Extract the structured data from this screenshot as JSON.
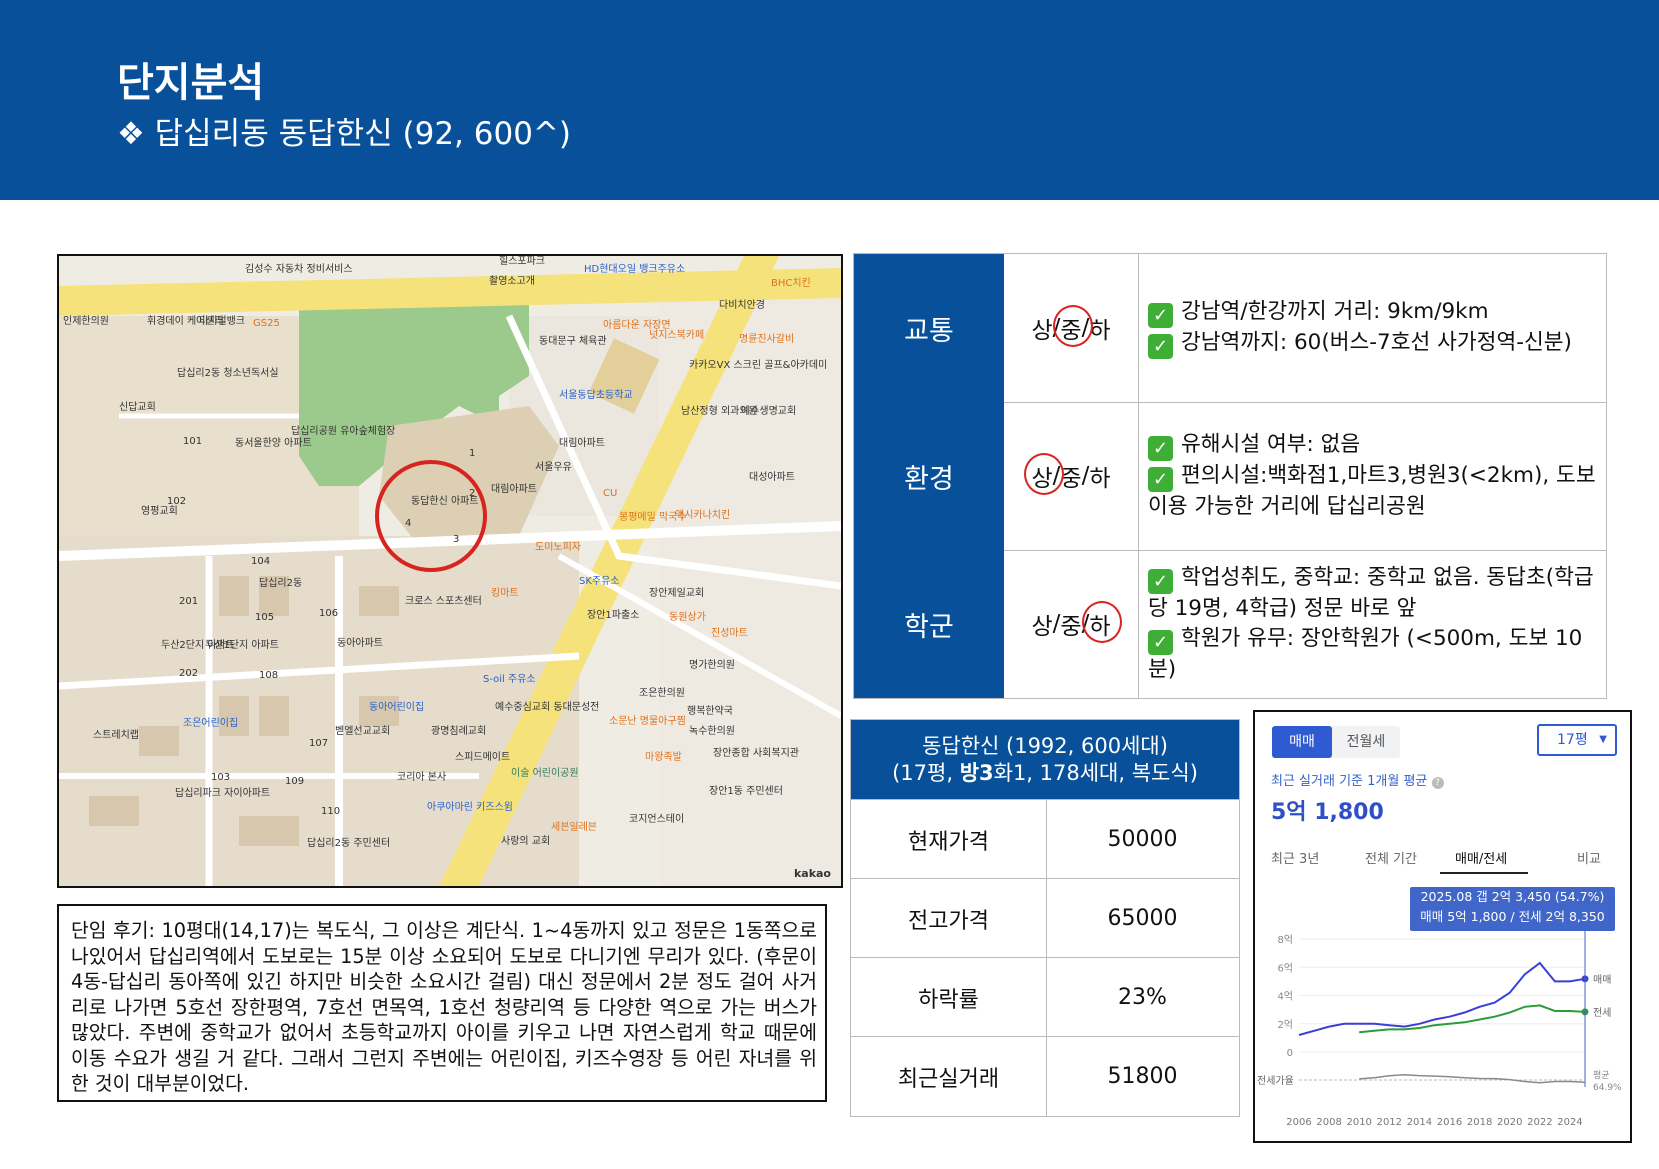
{
  "header": {
    "title": "단지분석",
    "subtitle": "❖ 답십리동 동답한신 (92, 600^)"
  },
  "map": {
    "labels": [
      "김성수 자동차 정비서비스",
      "힐스포파크",
      "HD현대오일 뱅크주유소",
      "인제한의원",
      "휘경데이 케어센터",
      "디지털뱅크",
      "GS25",
      "촬영소고개",
      "동대문구 체육관",
      "아름다운 자장면",
      "넛지스북카페",
      "다비치안경",
      "BHC치킨",
      "명륜진사갈비",
      "답십리2동 청소년독서실",
      "서울동답초등학교",
      "카카오VX 스크린 골프&아카데미",
      "신답교회",
      "남산정형 외과의원",
      "예수생명교회",
      "동서울한양 아파트",
      "답십리공원 유아숲체험장",
      "대림아파트",
      "동답한신 아파트",
      "서울우유",
      "대림아파트",
      "CU",
      "봉평메밀 막국수",
      "엑시카나치킨",
      "대성아파트",
      "영평교회",
      "도미노피자",
      "SK주유소",
      "답십리2동",
      "크로스 스포츠센터",
      "킹마트",
      "장안제일교회",
      "장안1파출소",
      "동원상가",
      "진성마트",
      "두산2단지 아파트",
      "두산1단지 아파트",
      "동아아파트",
      "S-oil 주유소",
      "명가한의원",
      "조은어린이집",
      "동아어린이집",
      "예수중심교회 동대문성전",
      "조은한의원",
      "행복한약국",
      "소문난 명물아구찜",
      "녹수한의원",
      "스트레치랩",
      "벧엘선교교회",
      "광명침례교회",
      "스피드메이트",
      "마왕족발",
      "장안종합 사회복지관",
      "답십리파크 자이아파트",
      "코리아 본사",
      "이술 어린이공원",
      "장안1동 주민센터",
      "아쿠아마린 키즈스윔",
      "세븐일레븐",
      "코지언스테이",
      "사랑의 교회",
      "답십리2동 주민센터",
      "kakao"
    ],
    "numbers": [
      "101",
      "102",
      "103",
      "104",
      "105",
      "106",
      "107",
      "108",
      "109",
      "110",
      "201",
      "202",
      "1",
      "2",
      "3",
      "4"
    ]
  },
  "note": {
    "text": "단임 후기: 10평대(14,17)는 복도식, 그 이상은 계단식. 1~4동까지 있고 정문은 1동쪽으로 나있어서 답십리역에서 도보로는 15분 이상 소요되어 도보로 다니기엔 무리가 있다. (후문이 4동-답십리 동아쪽에 있긴 하지만 비슷한 소요시간 걸림) 대신 정문에서 2분 정도 걸어 사거리로 나가면 5호선 장한평역, 7호선 면목역, 1호선 청량리역 등 다양한 역으로 가는 버스가 많았다. 주변에 중학교가 없어서 초등학교까지 아이를 키우고 나면 자연스럽게 학교 때문에 이동 수요가 생길 거 같다. 그래서 그런지 주변에는 어린이집, 키즈수영장 등 어린 자녀를 위한 것이 대부분이었다."
  },
  "evaluation": [
    {
      "category": "교통",
      "g1": "상",
      "s1": " / ",
      "g2": "중",
      "s2": " / ",
      "g3": "하",
      "selected": "중",
      "lines": [
        "강남역/한강까지 거리: 9km/9km",
        "강남역까지: 60(버스-7호선 사가정역-신분)"
      ]
    },
    {
      "category": "환경",
      "g1": "상",
      "s1": " / ",
      "g2": "중",
      "s2": " / ",
      "g3": "하",
      "selected": "상",
      "lines": [
        "유해시설 여부: 없음",
        "편의시설:백화점1,마트3,병원3(<2km), 도보 이용 가능한 거리에 답십리공원"
      ]
    },
    {
      "category": "학군",
      "g1": "상",
      "s1": " / ",
      "g2": "중",
      "s2": " / ",
      "g3": "하",
      "selected": "하",
      "lines": [
        "학업성취도, 중학교: 중학교 없음. 동답초(학급당 19명, 4학급) 정문 바로 앞",
        "학원가 유무: 장안학원가 (<500m, 도보 10분)"
      ]
    }
  ],
  "price_table": {
    "title_line1": "동답한신 (1992, 600세대)",
    "title_line2_a": "(17평, ",
    "title_line2_b": "방3",
    "title_line2_c": "화1, 178세대, 복도식)",
    "rows": [
      {
        "label": "현재가격",
        "value": "50000"
      },
      {
        "label": "전고가격",
        "value": "65000"
      },
      {
        "label": "하락률",
        "value": "23%"
      },
      {
        "label": "최근실거래",
        "value": "51800"
      }
    ]
  },
  "chart_panel": {
    "tab_sale": "매매",
    "tab_rent": "전월세",
    "size_select": "17평",
    "subtitle": "최근 실거래 기준 1개월 평균",
    "avg_price": "5억 1,800",
    "period_tabs": [
      "최근 3년",
      "전체 기간",
      "매매/전세",
      "비교"
    ],
    "active_period_tab": "매매/전세",
    "tooltip_line1": "2025.08  갭 2억 3,450 (54.7%)",
    "tooltip_line2": "매매 5억 1,800 / 전세 2억 8,350",
    "ratio_label": "전세가율",
    "avg_label": "평균",
    "avg_ratio": "64.9%"
  },
  "chart_data": {
    "type": "line",
    "x": [
      2006,
      2007,
      2008,
      2009,
      2010,
      2011,
      2012,
      2013,
      2014,
      2015,
      2016,
      2017,
      2018,
      2019,
      2020,
      2021,
      2022,
      2023,
      2024,
      2025
    ],
    "xticks": [
      "2006",
      "2008",
      "2010",
      "2012",
      "2014",
      "2016",
      "2018",
      "2020",
      "2022",
      "2024"
    ],
    "yticks": [
      "0",
      "2억",
      "4억",
      "6억",
      "8억"
    ],
    "ylim": [
      0,
      8
    ],
    "series": [
      {
        "name": "매매",
        "color": "#3a3fd6",
        "values": [
          1.2,
          1.5,
          1.8,
          2.0,
          2.0,
          2.0,
          1.9,
          1.8,
          2.0,
          2.3,
          2.5,
          2.8,
          3.2,
          3.5,
          4.2,
          5.5,
          6.3,
          5.0,
          5.0,
          5.18
        ]
      },
      {
        "name": "전세",
        "color": "#2f9a3a",
        "values": [
          null,
          null,
          null,
          null,
          1.4,
          1.5,
          1.6,
          1.6,
          1.7,
          1.9,
          2.0,
          2.1,
          2.3,
          2.5,
          2.8,
          3.2,
          3.3,
          2.9,
          2.9,
          2.84
        ]
      }
    ]
  },
  "colors": {
    "header_bg": "#08519a",
    "accent_blue": "#2f5bd2",
    "check_green": "#3fae36",
    "circle_red": "#d8241f"
  }
}
